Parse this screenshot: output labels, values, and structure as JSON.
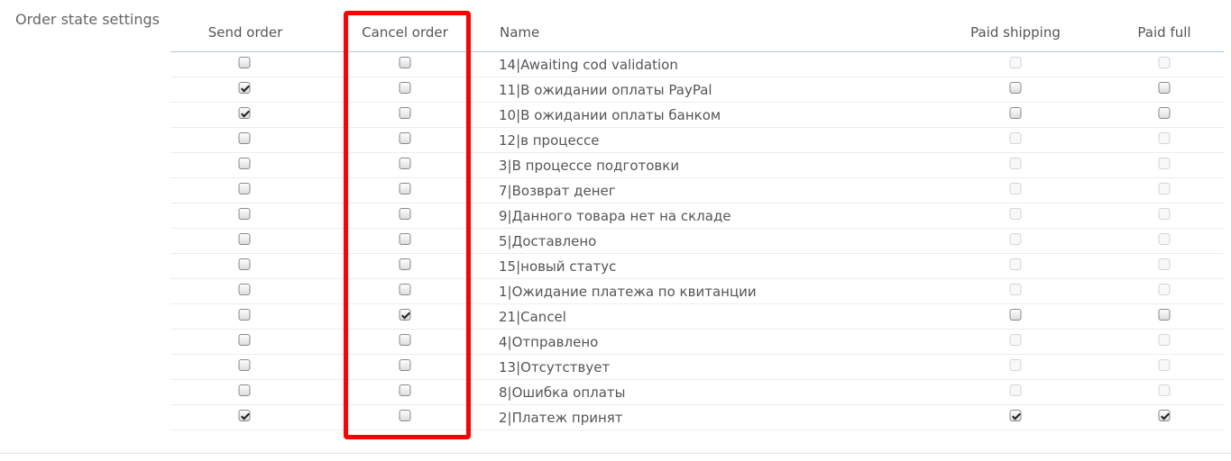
{
  "section": {
    "label": "Order state settings"
  },
  "columns": {
    "send_order": "Send order",
    "cancel_order": "Cancel order",
    "name": "Name",
    "paid_shipping": "Paid shipping",
    "paid_full": "Paid full"
  },
  "rows": [
    {
      "name": "14|Awaiting cod validation",
      "send": false,
      "cancel": false,
      "paid_shipping": false,
      "paid_full": false,
      "paid_enabled": false
    },
    {
      "name": "11|В ожидании оплаты PayPal",
      "send": true,
      "cancel": false,
      "paid_shipping": false,
      "paid_full": false,
      "paid_enabled": true
    },
    {
      "name": "10|В ожидании оплаты банком",
      "send": true,
      "cancel": false,
      "paid_shipping": false,
      "paid_full": false,
      "paid_enabled": true
    },
    {
      "name": "12|в процессе",
      "send": false,
      "cancel": false,
      "paid_shipping": false,
      "paid_full": false,
      "paid_enabled": false
    },
    {
      "name": "3|В процессе подготовки",
      "send": false,
      "cancel": false,
      "paid_shipping": false,
      "paid_full": false,
      "paid_enabled": false
    },
    {
      "name": "7|Возврат денег",
      "send": false,
      "cancel": false,
      "paid_shipping": false,
      "paid_full": false,
      "paid_enabled": false
    },
    {
      "name": "9|Данного товара нет на складе",
      "send": false,
      "cancel": false,
      "paid_shipping": false,
      "paid_full": false,
      "paid_enabled": false
    },
    {
      "name": "5|Доставлено",
      "send": false,
      "cancel": false,
      "paid_shipping": false,
      "paid_full": false,
      "paid_enabled": false
    },
    {
      "name": "15|новый статус",
      "send": false,
      "cancel": false,
      "paid_shipping": false,
      "paid_full": false,
      "paid_enabled": false
    },
    {
      "name": "1|Ожидание платежа по квитанции",
      "send": false,
      "cancel": false,
      "paid_shipping": false,
      "paid_full": false,
      "paid_enabled": false
    },
    {
      "name": "21|Cancel",
      "send": false,
      "cancel": true,
      "paid_shipping": false,
      "paid_full": false,
      "paid_enabled": true
    },
    {
      "name": "4|Отправлено",
      "send": false,
      "cancel": false,
      "paid_shipping": false,
      "paid_full": false,
      "paid_enabled": false
    },
    {
      "name": "13|Отсутствует",
      "send": false,
      "cancel": false,
      "paid_shipping": false,
      "paid_full": false,
      "paid_enabled": false
    },
    {
      "name": "8|Ошибка оплаты",
      "send": false,
      "cancel": false,
      "paid_shipping": false,
      "paid_full": false,
      "paid_enabled": false
    },
    {
      "name": "2|Платеж принят",
      "send": true,
      "cancel": false,
      "paid_shipping": true,
      "paid_full": true,
      "paid_enabled": true
    }
  ],
  "highlight": {
    "color": "#ff0000"
  }
}
